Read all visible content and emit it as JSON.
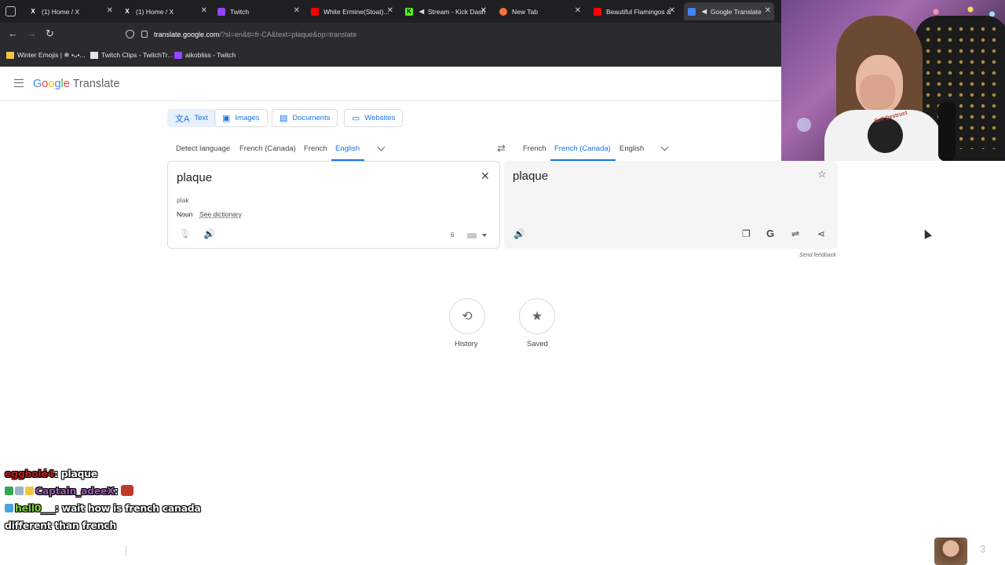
{
  "browser": {
    "tabs": [
      {
        "title": "(1) Home / X",
        "icon": "x-icon",
        "iconColor": "#ffffff"
      },
      {
        "title": "(1) Home / X",
        "icon": "x-icon",
        "iconColor": "#ffffff"
      },
      {
        "title": "Twitch",
        "icon": "twitch-icon",
        "iconColor": "#9146ff"
      },
      {
        "title": "White Ermine(Stoat)...",
        "icon": "youtube-icon",
        "iconColor": "#ff0000"
      },
      {
        "title": "Stream - Kick Dash",
        "icon": "kick-icon",
        "iconColor": "#53fc18"
      },
      {
        "title": "New Tab",
        "icon": "firefox-icon",
        "iconColor": "#ff7139"
      },
      {
        "title": "Beautiful Flamingos &",
        "icon": "youtube-icon",
        "iconColor": "#ff0000"
      },
      {
        "title": "Google Translate",
        "icon": "translate-icon",
        "iconColor": "#4285f4"
      }
    ],
    "tab_close": "✕",
    "url_host": "translate.google.com",
    "url_path": "/?sl=en&tl=fr-CA&text=plaque&op=translate",
    "bookmarks": [
      {
        "label": "Winter Emojis | ❄ •ᴗ•...",
        "color": "#f4c542"
      },
      {
        "label": "Twitch Clips - TwitchTr...",
        "color": "#e6e6e6"
      },
      {
        "label": "aikobliss - Twitch",
        "color": "#9146ff"
      }
    ]
  },
  "translate": {
    "brand": "Translate",
    "modes": [
      {
        "label": "Text",
        "icon": "translate-icon",
        "glyph": "文A"
      },
      {
        "label": "Images",
        "icon": "image-icon",
        "glyph": "▣"
      },
      {
        "label": "Documents",
        "icon": "document-icon",
        "glyph": "▤"
      },
      {
        "label": "Websites",
        "icon": "website-icon",
        "glyph": "▭"
      }
    ],
    "source_langs": [
      "Detect language",
      "French (Canada)",
      "French",
      "English"
    ],
    "target_langs": [
      "French",
      "French (Canada)",
      "English"
    ],
    "source_text": "plaque",
    "transliteration": "plak",
    "part_of_speech": "Noun",
    "see_dictionary": "See dictionary",
    "char_count": "6",
    "target_text": "plaque",
    "send_feedback": "Send feedback",
    "history_label": "History",
    "saved_label": "Saved"
  },
  "stream": {
    "shirt_text": "Self Destruct",
    "chat": [
      {
        "user": "eggbolé4",
        "sep": ":",
        "message": " plaque"
      },
      {
        "user": "Captain_adeeX",
        "sep": ":",
        "message": ""
      },
      {
        "user": "hell0___",
        "sep": ":",
        "message": " wait how is french canada"
      },
      {
        "user": "",
        "sep": "",
        "message": "different than french"
      }
    ],
    "viewer_count": "3"
  }
}
